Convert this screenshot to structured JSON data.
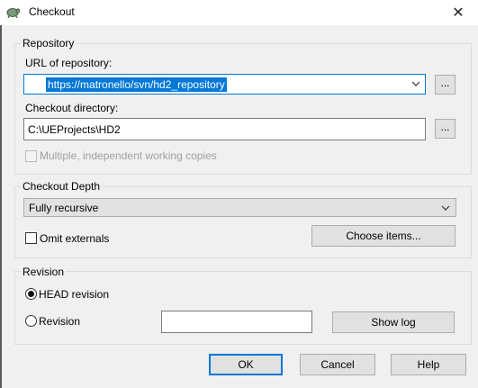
{
  "window": {
    "title": "Checkout",
    "close_glyph": "✕",
    "icon": "tortoisesvn-icon"
  },
  "repository": {
    "legend": "Repository",
    "url_label": "URL of repository:",
    "url_value": "https://matronello/svn/hd2_repository",
    "url_browse": "...",
    "dir_label": "Checkout directory:",
    "dir_value": "C:\\UEProjects\\HD2",
    "dir_browse": "...",
    "multiple_label": "Multiple, independent working copies",
    "multiple_checked": false
  },
  "depth": {
    "legend": "Checkout Depth",
    "selected": "Fully recursive",
    "omit_label": "Omit externals",
    "omit_checked": false,
    "choose_label": "Choose items..."
  },
  "revision": {
    "legend": "Revision",
    "head_label": "HEAD revision",
    "revision_label": "Revision",
    "revision_value": "",
    "selected": "head",
    "show_log_label": "Show log"
  },
  "buttons": {
    "ok": "OK",
    "cancel": "Cancel",
    "help": "Help"
  },
  "colors": {
    "accent": "#0078d7",
    "background": "#f0f0f0",
    "button": "#e1e1e1"
  }
}
